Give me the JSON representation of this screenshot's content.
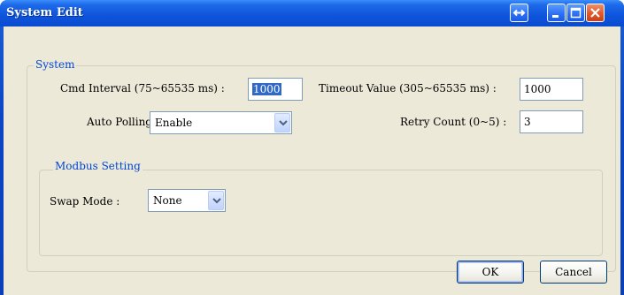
{
  "window": {
    "title": "System Edit"
  },
  "system_group": {
    "label": "System",
    "cmd_interval": {
      "label": "Cmd Interval (75~65535 ms) :",
      "value": "1000"
    },
    "timeout_value": {
      "label": "Timeout Value (305~65535 ms) :",
      "value": "1000"
    },
    "auto_polling": {
      "label": "Auto Polling :",
      "value": "Enable"
    },
    "retry_count": {
      "label": "Retry Count (0~5) :",
      "value": "3"
    }
  },
  "modbus_group": {
    "label": "Modbus Setting",
    "swap_mode": {
      "label": "Swap Mode :",
      "value": "None"
    }
  },
  "buttons": {
    "ok": "OK",
    "cancel": "Cancel"
  },
  "icons": {
    "resize": "resize-arrows-icon",
    "minimize": "minimize-icon",
    "maximize": "maximize-icon",
    "close": "close-icon",
    "dropdown": "chevron-down-icon"
  }
}
